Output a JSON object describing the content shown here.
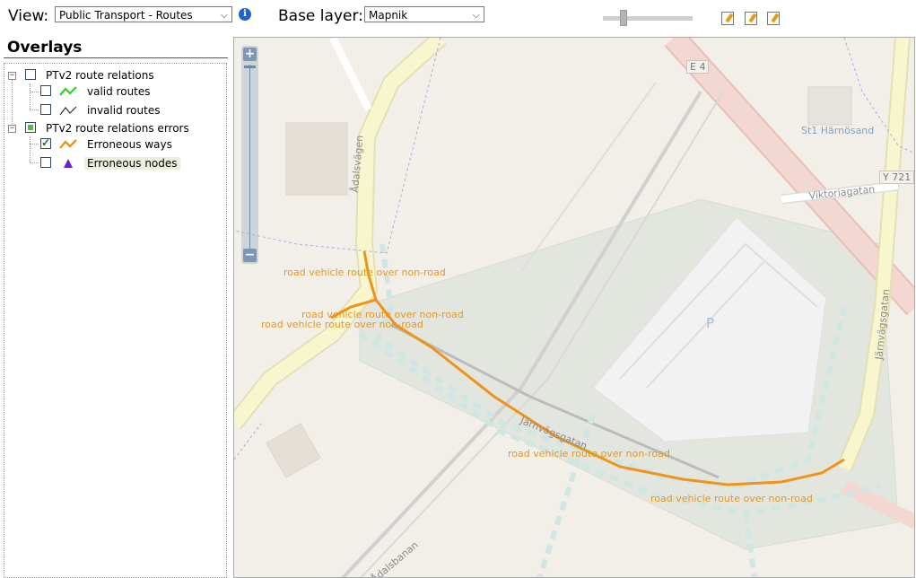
{
  "toolbar": {
    "view_label": "View:",
    "view_value": "Public Transport - Routes",
    "base_label": "Base layer:",
    "base_value": "Mapnik",
    "info_icon": "info-icon",
    "edit_icons": [
      "edit-josm-icon",
      "edit-potlatch-icon",
      "edit-id-icon"
    ]
  },
  "sidebar": {
    "title": "Overlays",
    "groups": [
      {
        "label": "PTv2 route relations",
        "state": "unchecked",
        "items": [
          {
            "label": "valid routes",
            "checked": false,
            "icon": "green-line-icon",
            "color": "#2ad22a"
          },
          {
            "label": "invalid routes",
            "checked": false,
            "icon": "black-line-icon",
            "color": "#333333"
          }
        ]
      },
      {
        "label": "PTv2 route relations errors",
        "state": "partial",
        "items": [
          {
            "label": "Erroneous ways",
            "checked": true,
            "icon": "orange-line-icon",
            "color": "#f0931a"
          },
          {
            "label": "Erroneous nodes",
            "checked": false,
            "icon": "purple-triangle-icon",
            "color": "#6a1ee0"
          }
        ]
      }
    ]
  },
  "map": {
    "zoom_in": "+",
    "zoom_out": "−",
    "error_label": "road vehicle route over non-road",
    "road_labels": {
      "adalsvagen": "Ådalsvägen",
      "jarnvagsgatan_left": "Järnvägsgatan",
      "jarnvagsgatan_right": "Järnvägsgatan",
      "viktoriagatan": "Viktoriagatan",
      "adalsbanan": "Ådalsbanan",
      "road_bottom_right": "road vehicle route over non-road"
    },
    "poi_label": "St1 Härnösand",
    "shield_e4": "E 4",
    "shield_y721": "Y 721",
    "parking": "P",
    "error_color": "#f0931a"
  }
}
